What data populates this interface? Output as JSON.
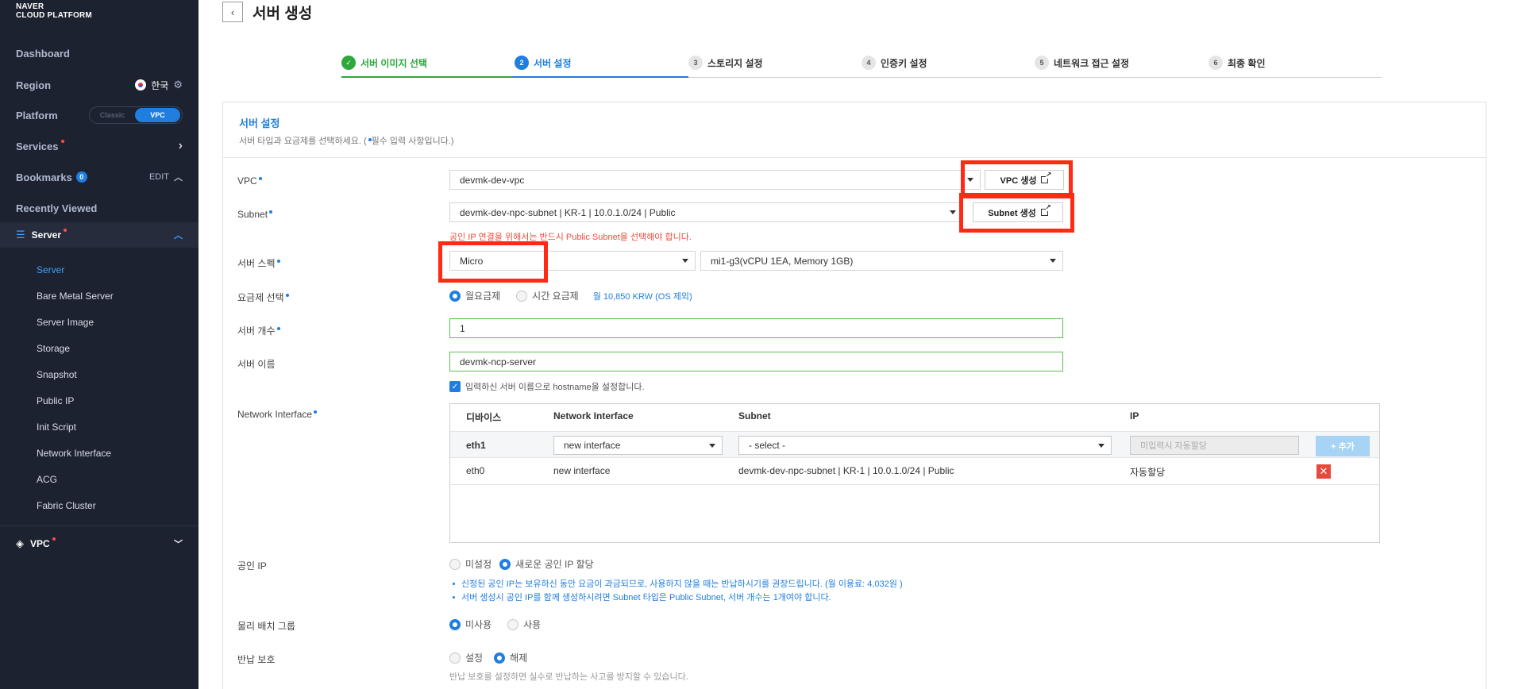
{
  "sidebar": {
    "logo_line1": "NAVER",
    "logo_line2": "CLOUD PLATFORM",
    "dashboard": "Dashboard",
    "region_label": "Region",
    "region_value": "한국",
    "platform_label": "Platform",
    "platform_opts": [
      "Classic",
      "VPC"
    ],
    "services": "Services",
    "bookmarks": "Bookmarks",
    "bookmarks_count": "0",
    "edit": "EDIT",
    "recently_viewed": "Recently Viewed",
    "server": "Server",
    "server_items": [
      "Server",
      "Bare Metal Server",
      "Server Image",
      "Storage",
      "Snapshot",
      "Public IP",
      "Init Script",
      "Network Interface",
      "ACG",
      "Fabric Cluster"
    ],
    "vpc": "VPC"
  },
  "header": {
    "title": "서버 생성"
  },
  "steps": [
    {
      "num": "✓",
      "label": "서버 이미지 선택"
    },
    {
      "num": "2",
      "label": "서버 설정"
    },
    {
      "num": "3",
      "label": "스토리지 설정"
    },
    {
      "num": "4",
      "label": "인증키 설정"
    },
    {
      "num": "5",
      "label": "네트워크 접근 설정"
    },
    {
      "num": "6",
      "label": "최종 확인"
    }
  ],
  "section": {
    "title": "서버 설정",
    "desc_a": "서버 타입과 요금제를 선택하세요. (",
    "desc_b": "필수 입력 사항입니다.)"
  },
  "form": {
    "vpc_label": "VPC",
    "vpc_value": "devmk-dev-vpc",
    "vpc_button": "VPC 생성",
    "subnet_label": "Subnet",
    "subnet_value": "devmk-dev-npc-subnet | KR-1 | 10.0.1.0/24 | Public",
    "subnet_button": "Subnet 생성",
    "subnet_warning": "공인 IP 연결을 위해서는 반드시 Public Subnet을 선택해야 합니다.",
    "spec_label": "서버 스펙",
    "spec_type": "Micro",
    "spec_detail": "mi1-g3(vCPU 1EA, Memory 1GB)",
    "pricing_label": "요금제 선택",
    "pricing_monthly": "월요금제",
    "pricing_hourly": "시간 요금제",
    "pricing_price": "월 10,850 KRW (OS 제외)",
    "count_label": "서버 개수",
    "count_value": "1",
    "name_label": "서버 이름",
    "name_value": "devmk-ncp-server",
    "hostname_check": "입력하신 서버 이름으로 hostname을 설정합니다.",
    "ni_label": "Network Interface",
    "public_ip_label": "공인 IP",
    "public_ip_opt1": "미설정",
    "public_ip_opt2": "새로운 공인 IP 할당",
    "public_ip_note1": "신청된 공인 IP는 보유하신 동안 요금이 과금되므로, 사용하지 않을 때는 반납하시기를 권장드립니다. (월 이용료: 4,032원 )",
    "public_ip_note2": "서버 생성시 공인 IP를 함께 생성하시려면 Subnet 타입은 Public Subnet, 서버 개수는 1개여야 합니다.",
    "placement_label": "물리 배치 그룹",
    "placement_opt1": "미사용",
    "placement_opt2": "사용",
    "protect_label": "반납 보호",
    "protect_opt1": "설정",
    "protect_opt2": "해제",
    "protect_note": "반납 보호를 설정하면 실수로 반납하는 사고를 방지할 수 있습니다."
  },
  "ni_table": {
    "headers": [
      "디바이스",
      "Network Interface",
      "Subnet",
      "IP"
    ],
    "row_new": {
      "device": "eth1",
      "ni": "new interface",
      "subnet": "- select -",
      "ip_placeholder": "미입력시 자동할당",
      "add": "+ 추가"
    },
    "row_existing": {
      "device": "eth0",
      "ni": "new interface",
      "subnet": "devmk-dev-npc-subnet | KR-1 | 10.0.1.0/24 | Public",
      "ip": "자동할당",
      "remove": "✕"
    }
  },
  "colors": {
    "accent": "#1f7ee0",
    "success": "#2ea73c",
    "highlight": "#ff2a14",
    "sidebar_bg": "#1d2230"
  }
}
